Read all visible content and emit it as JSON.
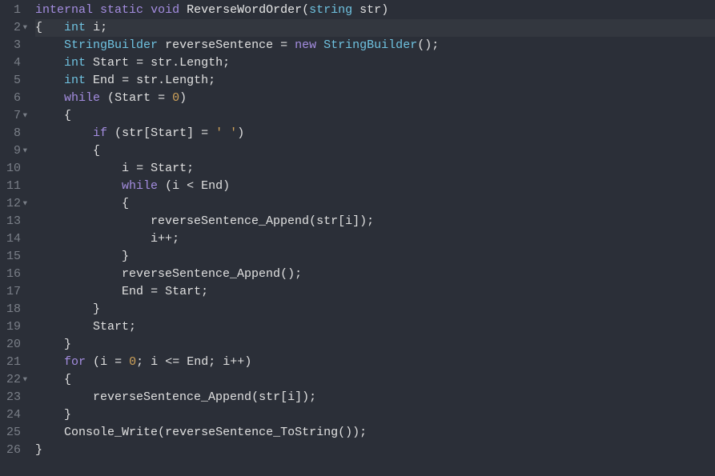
{
  "editor": {
    "highlight_line": 2,
    "lines": [
      {
        "n": 1,
        "fold": false,
        "tokens": [
          [
            "kw",
            "internal"
          ],
          [
            "sp",
            " "
          ],
          [
            "kw",
            "static"
          ],
          [
            "sp",
            " "
          ],
          [
            "kw",
            "void"
          ],
          [
            "sp",
            " "
          ],
          [
            "fn",
            "ReverseWordOrder"
          ],
          [
            "pun",
            "("
          ],
          [
            "type",
            "string"
          ],
          [
            "sp",
            " "
          ],
          [
            "id",
            "str"
          ],
          [
            "pun",
            ")"
          ]
        ]
      },
      {
        "n": 2,
        "fold": true,
        "tokens": [
          [
            "pun",
            "{"
          ],
          [
            "sp",
            "   "
          ],
          [
            "type",
            "int"
          ],
          [
            "sp",
            " "
          ],
          [
            "id",
            "i"
          ],
          [
            "pun",
            ";"
          ]
        ]
      },
      {
        "n": 3,
        "fold": false,
        "tokens": [
          [
            "sp",
            "    "
          ],
          [
            "type",
            "StringBuilder"
          ],
          [
            "sp",
            " "
          ],
          [
            "id",
            "reverseSentence"
          ],
          [
            "sp",
            " "
          ],
          [
            "op",
            "="
          ],
          [
            "sp",
            " "
          ],
          [
            "kw",
            "new"
          ],
          [
            "sp",
            " "
          ],
          [
            "type",
            "StringBuilder"
          ],
          [
            "pun",
            "()"
          ],
          [
            "pun",
            ";"
          ]
        ]
      },
      {
        "n": 4,
        "fold": false,
        "tokens": [
          [
            "sp",
            "    "
          ],
          [
            "type",
            "int"
          ],
          [
            "sp",
            " "
          ],
          [
            "id",
            "Start"
          ],
          [
            "sp",
            " "
          ],
          [
            "op",
            "="
          ],
          [
            "sp",
            " "
          ],
          [
            "id",
            "str"
          ],
          [
            "pun",
            "."
          ],
          [
            "id",
            "Length"
          ],
          [
            "pun",
            ";"
          ]
        ]
      },
      {
        "n": 5,
        "fold": false,
        "tokens": [
          [
            "sp",
            "    "
          ],
          [
            "type",
            "int"
          ],
          [
            "sp",
            " "
          ],
          [
            "id",
            "End"
          ],
          [
            "sp",
            " "
          ],
          [
            "op",
            "="
          ],
          [
            "sp",
            " "
          ],
          [
            "id",
            "str"
          ],
          [
            "pun",
            "."
          ],
          [
            "id",
            "Length"
          ],
          [
            "pun",
            ";"
          ]
        ]
      },
      {
        "n": 6,
        "fold": false,
        "tokens": [
          [
            "sp",
            "    "
          ],
          [
            "kw",
            "while"
          ],
          [
            "sp",
            " "
          ],
          [
            "pun",
            "("
          ],
          [
            "id",
            "Start"
          ],
          [
            "sp",
            " "
          ],
          [
            "op",
            "="
          ],
          [
            "sp",
            " "
          ],
          [
            "num",
            "0"
          ],
          [
            "pun",
            ")"
          ]
        ]
      },
      {
        "n": 7,
        "fold": true,
        "tokens": [
          [
            "sp",
            "    "
          ],
          [
            "pun",
            "{"
          ]
        ]
      },
      {
        "n": 8,
        "fold": false,
        "tokens": [
          [
            "sp",
            "        "
          ],
          [
            "kw",
            "if"
          ],
          [
            "sp",
            " "
          ],
          [
            "pun",
            "("
          ],
          [
            "id",
            "str"
          ],
          [
            "pun",
            "["
          ],
          [
            "id",
            "Start"
          ],
          [
            "pun",
            "]"
          ],
          [
            "sp",
            " "
          ],
          [
            "op",
            "="
          ],
          [
            "sp",
            " "
          ],
          [
            "str",
            "' '"
          ],
          [
            "pun",
            ")"
          ]
        ]
      },
      {
        "n": 9,
        "fold": true,
        "tokens": [
          [
            "sp",
            "        "
          ],
          [
            "pun",
            "{"
          ]
        ]
      },
      {
        "n": 10,
        "fold": false,
        "tokens": [
          [
            "sp",
            "            "
          ],
          [
            "id",
            "i"
          ],
          [
            "sp",
            " "
          ],
          [
            "op",
            "="
          ],
          [
            "sp",
            " "
          ],
          [
            "id",
            "Start"
          ],
          [
            "pun",
            ";"
          ]
        ]
      },
      {
        "n": 11,
        "fold": false,
        "tokens": [
          [
            "sp",
            "            "
          ],
          [
            "kw",
            "while"
          ],
          [
            "sp",
            " "
          ],
          [
            "pun",
            "("
          ],
          [
            "id",
            "i"
          ],
          [
            "sp",
            " "
          ],
          [
            "op",
            "<"
          ],
          [
            "sp",
            " "
          ],
          [
            "id",
            "End"
          ],
          [
            "pun",
            ")"
          ]
        ]
      },
      {
        "n": 12,
        "fold": true,
        "tokens": [
          [
            "sp",
            "            "
          ],
          [
            "pun",
            "{"
          ]
        ]
      },
      {
        "n": 13,
        "fold": false,
        "tokens": [
          [
            "sp",
            "                "
          ],
          [
            "id",
            "reverseSentence_Append"
          ],
          [
            "pun",
            "("
          ],
          [
            "id",
            "str"
          ],
          [
            "pun",
            "["
          ],
          [
            "id",
            "i"
          ],
          [
            "pun",
            "])"
          ],
          [
            "pun",
            ";"
          ]
        ]
      },
      {
        "n": 14,
        "fold": false,
        "tokens": [
          [
            "sp",
            "                "
          ],
          [
            "id",
            "i"
          ],
          [
            "op",
            "++"
          ],
          [
            "pun",
            ";"
          ]
        ]
      },
      {
        "n": 15,
        "fold": false,
        "tokens": [
          [
            "sp",
            "            "
          ],
          [
            "pun",
            "}"
          ]
        ]
      },
      {
        "n": 16,
        "fold": false,
        "tokens": [
          [
            "sp",
            "            "
          ],
          [
            "id",
            "reverseSentence_Append"
          ],
          [
            "pun",
            "()"
          ],
          [
            "pun",
            ";"
          ]
        ]
      },
      {
        "n": 17,
        "fold": false,
        "tokens": [
          [
            "sp",
            "            "
          ],
          [
            "id",
            "End"
          ],
          [
            "sp",
            " "
          ],
          [
            "op",
            "="
          ],
          [
            "sp",
            " "
          ],
          [
            "id",
            "Start"
          ],
          [
            "pun",
            ";"
          ]
        ]
      },
      {
        "n": 18,
        "fold": false,
        "tokens": [
          [
            "sp",
            "        "
          ],
          [
            "pun",
            "}"
          ]
        ]
      },
      {
        "n": 19,
        "fold": false,
        "tokens": [
          [
            "sp",
            "        "
          ],
          [
            "id",
            "Start"
          ],
          [
            "pun",
            ";"
          ]
        ]
      },
      {
        "n": 20,
        "fold": false,
        "tokens": [
          [
            "sp",
            "    "
          ],
          [
            "pun",
            "}"
          ]
        ]
      },
      {
        "n": 21,
        "fold": false,
        "tokens": [
          [
            "sp",
            "    "
          ],
          [
            "kw",
            "for"
          ],
          [
            "sp",
            " "
          ],
          [
            "pun",
            "("
          ],
          [
            "id",
            "i"
          ],
          [
            "sp",
            " "
          ],
          [
            "op",
            "="
          ],
          [
            "sp",
            " "
          ],
          [
            "num",
            "0"
          ],
          [
            "pun",
            ";"
          ],
          [
            "sp",
            " "
          ],
          [
            "id",
            "i"
          ],
          [
            "sp",
            " "
          ],
          [
            "op",
            "<="
          ],
          [
            "sp",
            " "
          ],
          [
            "id",
            "End"
          ],
          [
            "pun",
            ";"
          ],
          [
            "sp",
            " "
          ],
          [
            "id",
            "i"
          ],
          [
            "op",
            "++"
          ],
          [
            "pun",
            ")"
          ]
        ]
      },
      {
        "n": 22,
        "fold": true,
        "tokens": [
          [
            "sp",
            "    "
          ],
          [
            "pun",
            "{"
          ]
        ]
      },
      {
        "n": 23,
        "fold": false,
        "tokens": [
          [
            "sp",
            "        "
          ],
          [
            "id",
            "reverseSentence_Append"
          ],
          [
            "pun",
            "("
          ],
          [
            "id",
            "str"
          ],
          [
            "pun",
            "["
          ],
          [
            "id",
            "i"
          ],
          [
            "pun",
            "])"
          ],
          [
            "pun",
            ";"
          ]
        ]
      },
      {
        "n": 24,
        "fold": false,
        "tokens": [
          [
            "sp",
            "    "
          ],
          [
            "pun",
            "}"
          ]
        ]
      },
      {
        "n": 25,
        "fold": false,
        "tokens": [
          [
            "sp",
            "    "
          ],
          [
            "id",
            "Console_Write"
          ],
          [
            "pun",
            "("
          ],
          [
            "id",
            "reverseSentence_ToString"
          ],
          [
            "pun",
            "())"
          ],
          [
            "pun",
            ";"
          ]
        ]
      },
      {
        "n": 26,
        "fold": false,
        "tokens": [
          [
            "pun",
            "}"
          ]
        ]
      }
    ]
  }
}
